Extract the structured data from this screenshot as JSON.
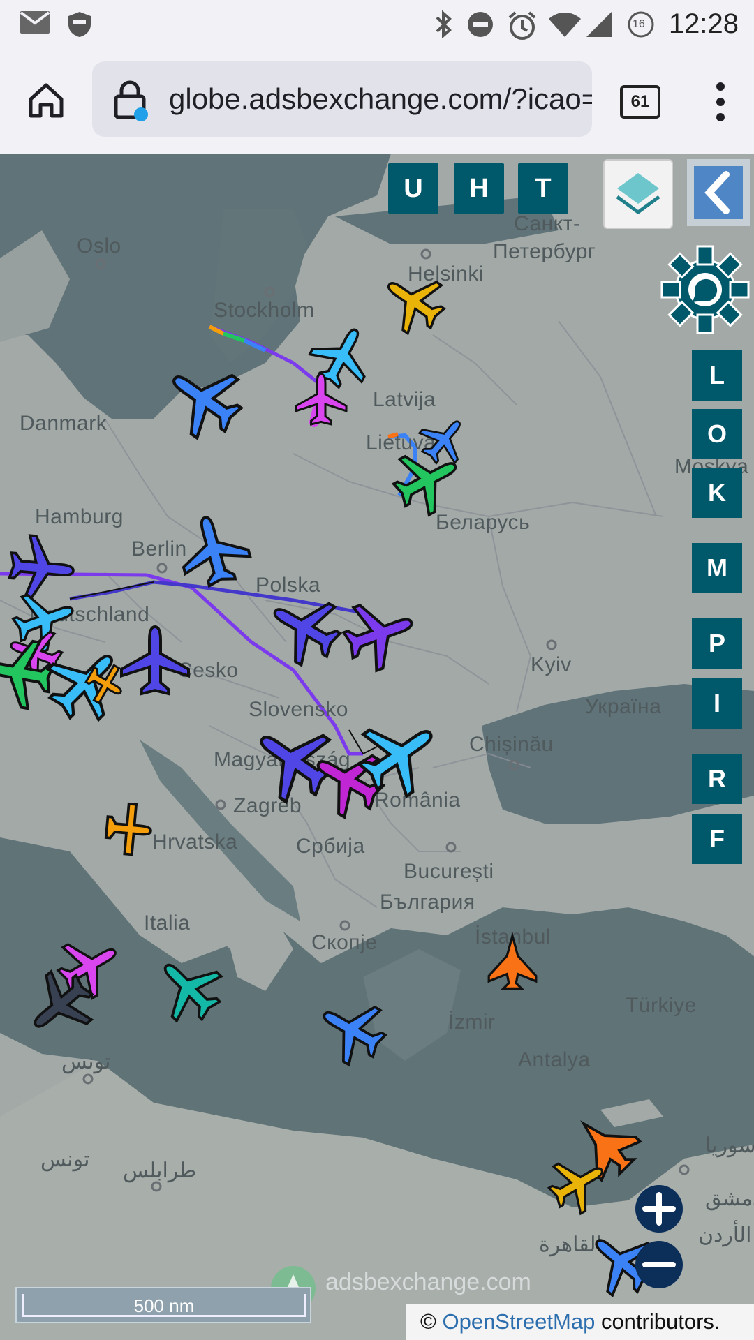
{
  "status_bar": {
    "time": "12:28",
    "notification_badge": "16",
    "icons": [
      "mail-icon",
      "shield-icon",
      "bluetooth-icon",
      "do-not-disturb-icon",
      "alarm-icon",
      "wifi-icon",
      "cellular-signal-icon",
      "data-saver-icon"
    ]
  },
  "browser": {
    "url": "globe.adsbexchange.com/?icao=",
    "tab_count": "61",
    "icons": [
      "home-icon",
      "lock-icon",
      "menu-dots-icon"
    ]
  },
  "map": {
    "top_buttons": [
      "U",
      "H",
      "T"
    ],
    "right_buttons": [
      "L",
      "O",
      "K",
      "M",
      "P",
      "I",
      "R",
      "F"
    ],
    "labels": [
      {
        "text": "Oslo",
        "key": "oslo"
      },
      {
        "text": "Stockholm",
        "key": "stockholm"
      },
      {
        "text": "Helsinki",
        "key": "helsinki"
      },
      {
        "text": "Санкт-",
        "key": "spb1"
      },
      {
        "text": "Петербург",
        "key": "spb2"
      },
      {
        "text": "Latvija",
        "key": "latvija"
      },
      {
        "text": "Danmark",
        "key": "danmark"
      },
      {
        "text": "Lietuva",
        "key": "lietuva"
      },
      {
        "text": "Hamburg",
        "key": "hamburg"
      },
      {
        "text": "Berlin",
        "key": "berlin"
      },
      {
        "text": "Беларусь",
        "key": "belarus"
      },
      {
        "text": "Polska",
        "key": "polska"
      },
      {
        "text": "Deutschland",
        "key": "deutschland"
      },
      {
        "text": "Cesko",
        "key": "cesko"
      },
      {
        "text": "Kyiv",
        "key": "kyiv"
      },
      {
        "text": "Україна",
        "key": "ukraina"
      },
      {
        "text": "Slovensko",
        "key": "slovensko"
      },
      {
        "text": "Chișinău",
        "key": "chisinau"
      },
      {
        "text": "Magyarország",
        "key": "magyar"
      },
      {
        "text": "Zagreb",
        "key": "zagreb"
      },
      {
        "text": "România",
        "key": "romania"
      },
      {
        "text": "Hrvatska",
        "key": "hrvatska"
      },
      {
        "text": "Србија",
        "key": "srbija"
      },
      {
        "text": "București",
        "key": "bucuresti"
      },
      {
        "text": "България",
        "key": "bulgaria"
      },
      {
        "text": "Italia",
        "key": "italia"
      },
      {
        "text": "Скопје",
        "key": "skopje"
      },
      {
        "text": "İstanbul",
        "key": "istanbul"
      },
      {
        "text": "İzmir",
        "key": "izmir"
      },
      {
        "text": "Türkiye",
        "key": "turkiye"
      },
      {
        "text": "Antalya",
        "key": "antalya"
      },
      {
        "text": "تونس",
        "key": "tunis"
      },
      {
        "text": "تونس",
        "key": "tunisia"
      },
      {
        "text": "طرابلس",
        "key": "tripoli"
      },
      {
        "text": "القاهرة",
        "key": "cairo"
      },
      {
        "text": "سوريا",
        "key": "syria"
      },
      {
        "text": "الأردن",
        "key": "jordan"
      },
      {
        "text": "دمشق",
        "key": "damascus"
      },
      {
        "text": "Moskva",
        "key": "moskva"
      }
    ],
    "scale_label": "500 nm",
    "watermark": "adsbexchange.com",
    "attribution_prefix": "© ",
    "attribution_link": "OpenStreetMap",
    "attribution_suffix": " contributors.",
    "aircraft_colors": [
      "#3b82f6",
      "#4f46e5",
      "#7c3aed",
      "#d946ef",
      "#22c55e",
      "#eab308",
      "#f97316",
      "#14b8a6",
      "#374151",
      "#38bdf8",
      "#f59e0b"
    ]
  }
}
